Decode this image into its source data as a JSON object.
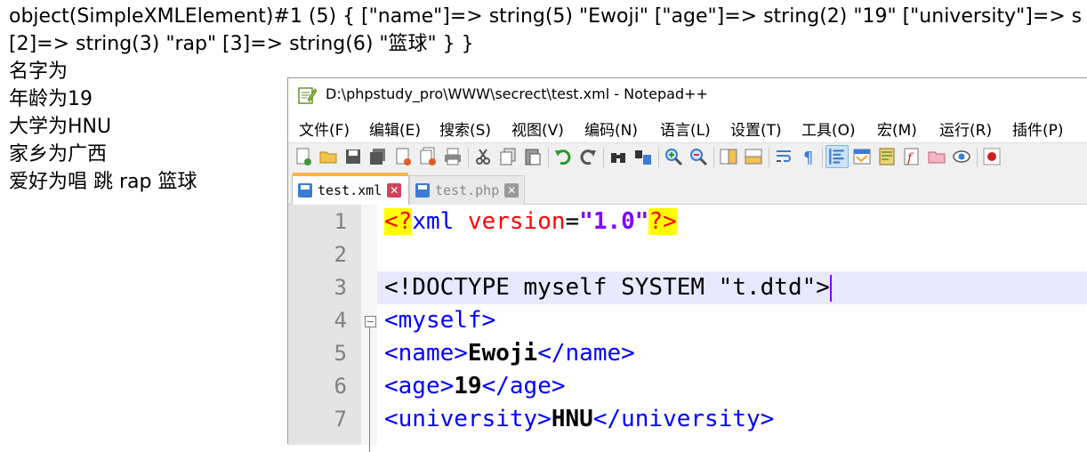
{
  "output": {
    "lines": [
      "object(SimpleXMLElement)#1 (5) { [\"name\"]=> string(5) \"Ewoji\" [\"age\"]=> string(2) \"19\" [\"university\"]=> s",
      "[2]=> string(3) \"rap\" [3]=> string(6) \"篮球\" } }",
      "名字为",
      "年龄为19",
      "大学为HNU",
      "家乡为广西",
      "爱好为唱 跳 rap 篮球"
    ]
  },
  "window": {
    "title": "D:\\phpstudy_pro\\WWW\\secrect\\test.xml - Notepad++"
  },
  "menu": [
    "文件(F)",
    "编辑(E)",
    "搜索(S)",
    "视图(V)",
    "编码(N)",
    "语言(L)",
    "设置(T)",
    "工具(O)",
    "宏(M)",
    "运行(R)",
    "插件(P)"
  ],
  "tabs": [
    {
      "label": "test.xml",
      "active": true
    },
    {
      "label": "test.php",
      "active": false
    }
  ],
  "editor": {
    "line_numbers": [
      "1",
      "2",
      "3",
      "4",
      "5",
      "6",
      "7"
    ],
    "lines": [
      {
        "pi_open": "<?",
        "decl": "xml",
        "attr": " version",
        "eq": "=",
        "val": "\"1.0\"",
        "pi_close": "?>"
      },
      {},
      {
        "text": "<!DOCTYPE myself SYSTEM \"t.dtd\">"
      },
      {
        "tag": "<myself>"
      },
      {
        "open": "<name>",
        "content": "Ewoji",
        "close": "</name>"
      },
      {
        "open": "<age>",
        "content": "19",
        "close": "</age>"
      },
      {
        "open": "<university>",
        "content": "HNU",
        "close": "</university>"
      }
    ]
  },
  "colors": {
    "tag": "#0000ff",
    "attr": "#ff0000",
    "value": "#8000ff",
    "pi_bg": "#ffff00",
    "current_line": "#e8e8ff",
    "tab_accent": "#ffb341"
  }
}
